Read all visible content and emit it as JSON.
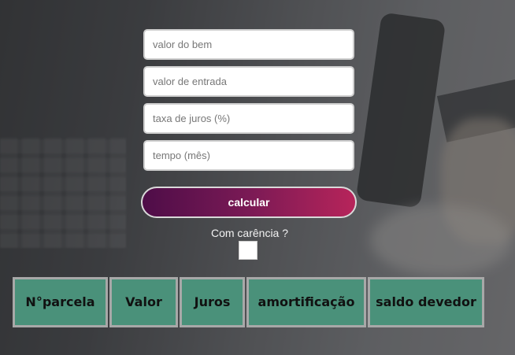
{
  "form": {
    "valor_bem_placeholder": "valor do bem",
    "valor_entrada_placeholder": "valor de entrada",
    "taxa_juros_placeholder": "taxa de juros (%)",
    "tempo_placeholder": "tempo (mês)"
  },
  "calc_button_label": "calcular",
  "carencia": {
    "label": "Com carência ?",
    "checked": false
  },
  "table": {
    "headers": [
      "N°parcela",
      "Valor",
      "Juros",
      "amortificação",
      "saldo devedor"
    ]
  },
  "colors": {
    "header_bg": "#4a917a",
    "button_gradient_start": "#4e0d48",
    "button_gradient_end": "#b7245a"
  }
}
